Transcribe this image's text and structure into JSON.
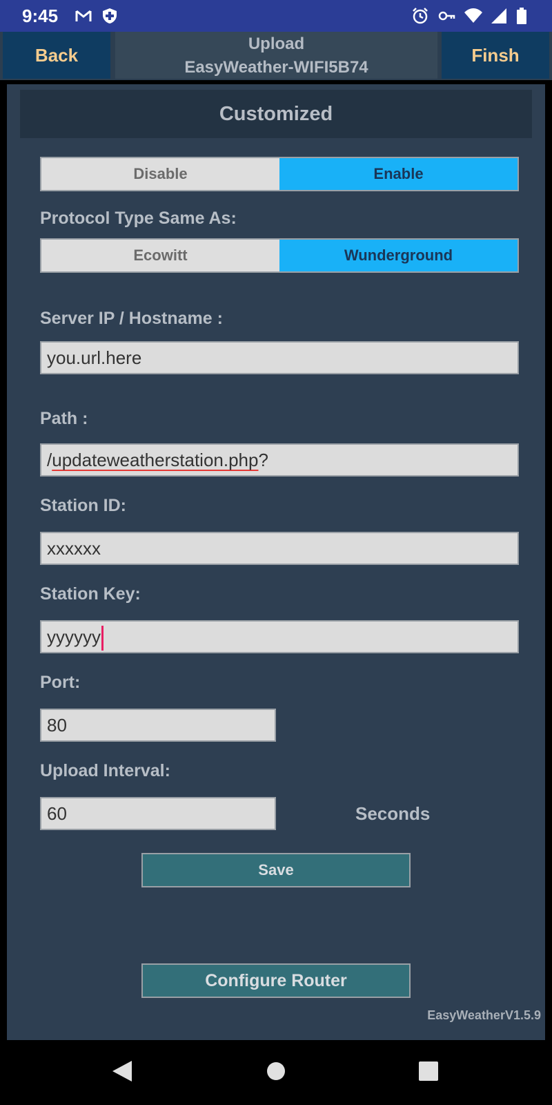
{
  "status_bar": {
    "time": "9:45",
    "left_icons": [
      "gmail-icon",
      "shield-icon"
    ],
    "right_icons": [
      "alarm-icon",
      "vpn-key-icon",
      "wifi-icon",
      "signal-icon",
      "battery-icon"
    ]
  },
  "header": {
    "back_label": "Back",
    "title_line1": "Upload",
    "title_line2": "EasyWeather-WIFI5B74",
    "finish_label": "Finsh"
  },
  "section": {
    "title": "Customized"
  },
  "toggle": {
    "disable_label": "Disable",
    "enable_label": "Enable",
    "selected": "Enable"
  },
  "protocol": {
    "label": "Protocol Type Same As:",
    "ecowitt_label": "Ecowitt",
    "wunderground_label": "Wunderground",
    "selected": "Wunderground"
  },
  "server": {
    "label": "Server IP / Hostname :",
    "value": "you.url.here"
  },
  "path": {
    "label": "Path :",
    "value_prefix": "/",
    "value_main": "updateweatherstation.php",
    "value_suffix": "?"
  },
  "station_id": {
    "label": "Station ID:",
    "value": "xxxxxx"
  },
  "station_key": {
    "label": "Station Key:",
    "value": "yyyyyy"
  },
  "port": {
    "label": "Port:",
    "value": "80"
  },
  "upload_interval": {
    "label": "Upload Interval:",
    "value": "60",
    "unit": "Seconds"
  },
  "save_label": "Save",
  "configure_router_label": "Configure Router",
  "version": "EasyWeatherV1.5.9",
  "nav_bar": {
    "icons": [
      "back-triangle-icon",
      "home-circle-icon",
      "recents-square-icon"
    ]
  },
  "colors": {
    "status_bar": "#2b3d96",
    "header_button": "#0f3c61",
    "header_button_text": "#f6cc8e",
    "content_bg": "#2e3f52",
    "selected_segment": "#19b1f7",
    "action_button": "#336f79"
  }
}
